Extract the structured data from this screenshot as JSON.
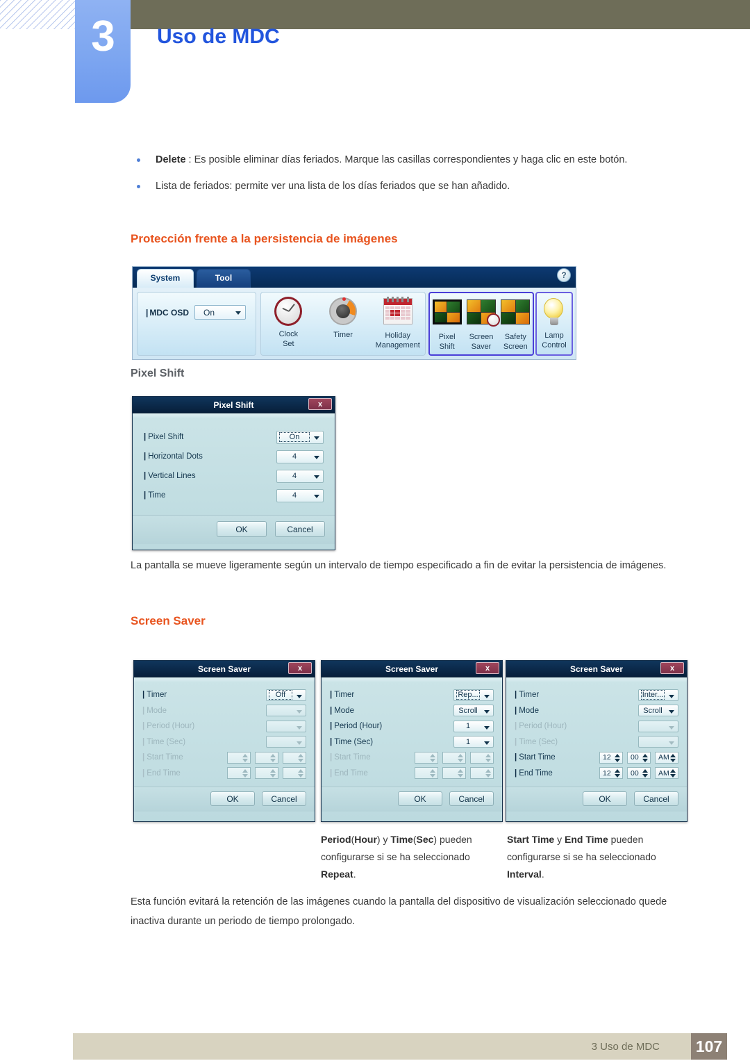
{
  "header": {
    "chapter_number": "3",
    "chapter_title": "Uso de MDC"
  },
  "bullets": [
    {
      "bold": "Delete",
      "text": " : Es posible eliminar días feriados. Marque las casillas correspondientes y haga clic en este botón."
    },
    {
      "bold": "",
      "text": "Lista de feriados: permite ver una lista de los días feriados que se han añadido."
    }
  ],
  "sections": {
    "proteccion_heading": "Protección frente a la persistencia de imágenes",
    "pixel_shift_subheading": "Pixel Shift",
    "pixel_shift_paragraph": "La pantalla se mueve ligeramente según un intervalo de tiempo especificado a fin de evitar la persistencia de imágenes.",
    "screen_saver_heading": "Screen Saver",
    "bottom_paragraph": "Esta función evitará la retención de las imágenes cuando la pantalla del dispositivo de visualización seleccionado quede inactiva durante un periodo de tiempo prolongado."
  },
  "mdc_toolbar": {
    "tabs": [
      {
        "label": "System",
        "active": true
      },
      {
        "label": "Tool",
        "active": false
      }
    ],
    "help_glyph": "?",
    "osd": {
      "label": "MDC OSD",
      "value": "On"
    },
    "groups": [
      {
        "name": "main-tools",
        "items": [
          {
            "icon": "clock-icon",
            "line1": "Clock",
            "line2": "Set"
          },
          {
            "icon": "timer-icon",
            "line1": "Timer",
            "line2": ""
          },
          {
            "icon": "calendar-icon",
            "line1": "Holiday",
            "line2": "Management"
          }
        ]
      },
      {
        "name": "protection-tools",
        "highlighted": true,
        "items": [
          {
            "icon": "pixel-shift-icon",
            "line1": "Pixel",
            "line2": "Shift"
          },
          {
            "icon": "screen-saver-icon",
            "line1": "Screen",
            "line2": "Saver"
          },
          {
            "icon": "safety-screen-icon",
            "line1": "Safety",
            "line2": "Screen"
          }
        ]
      },
      {
        "name": "lamp-tools",
        "highlighted": true,
        "items": [
          {
            "icon": "lamp-icon",
            "line1": "Lamp",
            "line2": "Control"
          }
        ]
      }
    ]
  },
  "pixel_shift_dialog": {
    "title": "Pixel Shift",
    "close_label": "x",
    "rows": [
      {
        "label": "Pixel Shift",
        "value": "On",
        "focused": true,
        "disabled": false
      },
      {
        "label": "Horizontal Dots",
        "value": "4",
        "focused": false,
        "disabled": false
      },
      {
        "label": "Vertical Lines",
        "value": "4",
        "focused": false,
        "disabled": false
      },
      {
        "label": "Time",
        "value": "4",
        "focused": false,
        "disabled": false
      }
    ],
    "ok_label": "OK",
    "cancel_label": "Cancel"
  },
  "screen_saver_dialogs": [
    {
      "title": "Screen Saver",
      "close_label": "x",
      "timer": {
        "label": "Timer",
        "value": "Off",
        "disabled": false,
        "focused": true
      },
      "mode": {
        "label": "Mode",
        "value": "",
        "disabled": true
      },
      "period": {
        "label": "Period (Hour)",
        "value": "",
        "disabled": true
      },
      "time": {
        "label": "Time (Sec)",
        "value": "",
        "disabled": true
      },
      "start_time": {
        "label": "Start Time",
        "hour": "",
        "minute": "",
        "meridiem": "",
        "disabled": true
      },
      "end_time": {
        "label": "End Time",
        "hour": "",
        "minute": "",
        "meridiem": "",
        "disabled": true
      },
      "ok_label": "OK",
      "cancel_label": "Cancel"
    },
    {
      "title": "Screen Saver",
      "close_label": "x",
      "timer": {
        "label": "Timer",
        "value": "Rep...",
        "disabled": false,
        "focused": true
      },
      "mode": {
        "label": "Mode",
        "value": "Scroll",
        "disabled": false
      },
      "period": {
        "label": "Period (Hour)",
        "value": "1",
        "disabled": false
      },
      "time": {
        "label": "Time (Sec)",
        "value": "1",
        "disabled": false
      },
      "start_time": {
        "label": "Start Time",
        "hour": "",
        "minute": "",
        "meridiem": "",
        "disabled": true
      },
      "end_time": {
        "label": "End Time",
        "hour": "",
        "minute": "",
        "meridiem": "",
        "disabled": true
      },
      "ok_label": "OK",
      "cancel_label": "Cancel"
    },
    {
      "title": "Screen Saver",
      "close_label": "x",
      "timer": {
        "label": "Timer",
        "value": "Inter...",
        "disabled": false,
        "focused": true
      },
      "mode": {
        "label": "Mode",
        "value": "Scroll",
        "disabled": false
      },
      "period": {
        "label": "Period (Hour)",
        "value": "",
        "disabled": true
      },
      "time": {
        "label": "Time (Sec)",
        "value": "",
        "disabled": true
      },
      "start_time": {
        "label": "Start Time",
        "hour": "12",
        "minute": "00",
        "meridiem": "AM",
        "disabled": false
      },
      "end_time": {
        "label": "End Time",
        "hour": "12",
        "minute": "00",
        "meridiem": "AM",
        "disabled": false
      },
      "ok_label": "OK",
      "cancel_label": "Cancel"
    }
  ],
  "captions": [
    {
      "b1": "Period",
      "p1": "(",
      "b2": "Hour",
      "p2": ") y  ",
      "b3": "Time",
      "p3": "(",
      "b4": "Sec",
      "p4": ") pueden configurarse si se ha seleccionado ",
      "b5": "Repeat",
      "p5": "."
    },
    {
      "b1": "Start Time",
      "p1": " y ",
      "b2": "End Time",
      "p2": " pueden configurarse si se ha seleccionado ",
      "b3": "Interval",
      "p3": "."
    }
  ],
  "footer": {
    "text": "3 Uso de MDC",
    "page_number": "107"
  },
  "colors": {
    "header_bar": "#6e6d58",
    "chapter_badge": "#7da6f0",
    "chapter_title": "#2255dd",
    "section_heading": "#e8541f",
    "sub_heading": "#5d6166",
    "footer_bar": "#d8d3c0",
    "page_box": "#8d8175",
    "bullet": "#4f7fd6",
    "highlight_border": "#4a3fd8"
  }
}
